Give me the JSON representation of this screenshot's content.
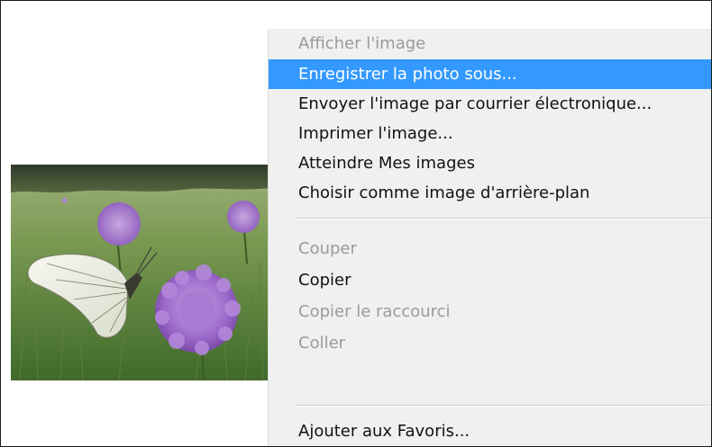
{
  "context_menu": {
    "items": [
      {
        "label": "Afficher l'image",
        "state": "disabled"
      },
      {
        "label": "Enregistrer la photo sous...",
        "state": "selected"
      },
      {
        "label": "Envoyer l'image par courrier électronique...",
        "state": "enabled"
      },
      {
        "label": "Imprimer l'image...",
        "state": "enabled"
      },
      {
        "label": "Atteindre Mes images",
        "state": "enabled"
      },
      {
        "label": "Choisir comme image d'arrière-plan",
        "state": "enabled"
      },
      {
        "label": "Couper",
        "state": "disabled"
      },
      {
        "label": "Copier",
        "state": "enabled"
      },
      {
        "label": "Copier le raccourci",
        "state": "disabled"
      },
      {
        "label": "Coller",
        "state": "disabled"
      },
      {
        "label": "Ajouter aux Favoris...",
        "state": "enabled"
      }
    ]
  },
  "colors": {
    "highlight": "#3399ff",
    "menu_background": "#f0f0f0",
    "disabled_text": "#9a9a9a"
  },
  "photo": {
    "subject": "white butterfly on purple scabious flowers in a green meadow"
  }
}
